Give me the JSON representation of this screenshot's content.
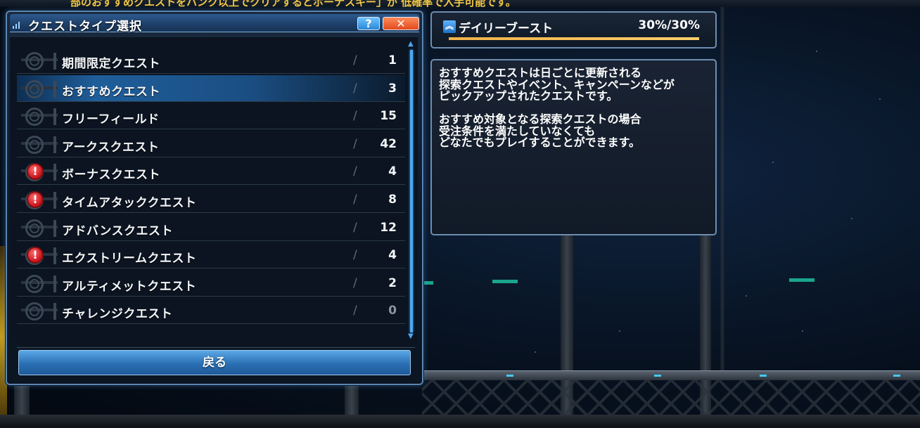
{
  "banner": {
    "text": "部のおすすめクエストをハンク以上でクリアするとボーナスキー」が 低確率で入手可能です。"
  },
  "window": {
    "title": "クエストタイプ選択",
    "help_label": "?",
    "close_label": "✕",
    "back_label": "戻る"
  },
  "quest_types": [
    {
      "label": "期間限定クエスト",
      "slash": "/",
      "count": "1",
      "alert": false,
      "selected": false
    },
    {
      "label": "おすすめクエスト",
      "slash": "/",
      "count": "3",
      "alert": false,
      "selected": true
    },
    {
      "label": "フリーフィールド",
      "slash": "/",
      "count": "15",
      "alert": false,
      "selected": false
    },
    {
      "label": "アークスクエスト",
      "slash": "/",
      "count": "42",
      "alert": false,
      "selected": false
    },
    {
      "label": "ボーナスクエスト",
      "slash": "/",
      "count": "4",
      "alert": true,
      "selected": false
    },
    {
      "label": "タイムアタッククエスト",
      "slash": "/",
      "count": "8",
      "alert": true,
      "selected": false
    },
    {
      "label": "アドバンスクエスト",
      "slash": "/",
      "count": "12",
      "alert": false,
      "selected": false
    },
    {
      "label": "エクストリームクエスト",
      "slash": "/",
      "count": "4",
      "alert": true,
      "selected": false
    },
    {
      "label": "アルティメットクエスト",
      "slash": "/",
      "count": "2",
      "alert": false,
      "selected": false
    },
    {
      "label": "チャレンジクエスト",
      "slash": "/",
      "count": "0",
      "alert": false,
      "selected": false
    }
  ],
  "daily_boost": {
    "icon": "double-chevron-up-icon",
    "name": "デイリーブースト",
    "value_text": "30%/30%",
    "fill_fraction": 1.0,
    "bar_color": "#f2b24a"
  },
  "description": {
    "lines": [
      "おすすめクエストは日ごとに更新される",
      "探索クエストやイベント、キャンペーンなどが",
      "ピックアップされたクエストです。",
      "",
      "おすすめ対象となる探索クエストの場合",
      "受注条件を満たしていなくても",
      "どなたでもプレイすることができます。"
    ]
  },
  "colors": {
    "accent": "#4fa7ee",
    "alert": "#c8121a",
    "close": "#e14b1e"
  }
}
